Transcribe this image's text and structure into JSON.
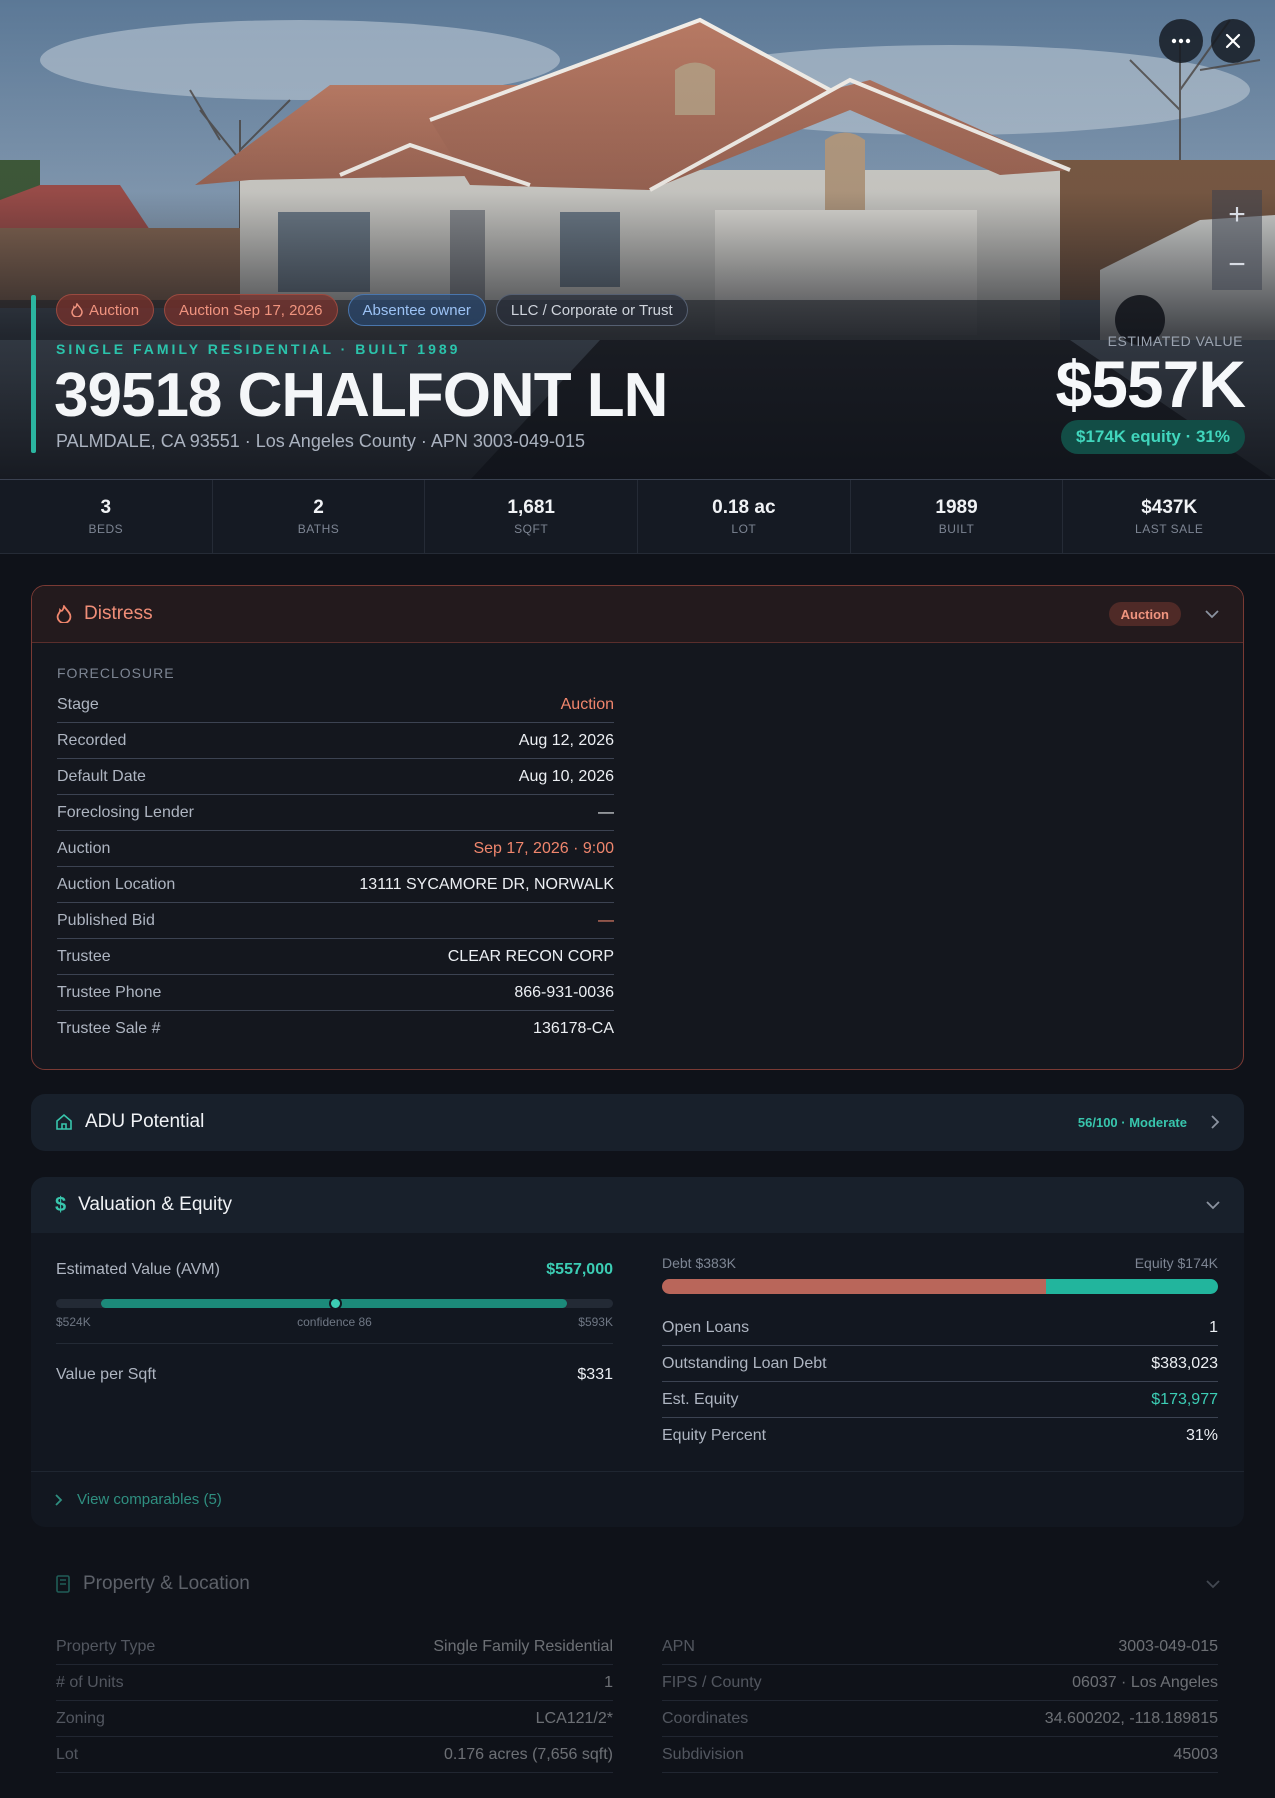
{
  "hero": {
    "tags": [
      {
        "label": "Auction",
        "style": "red",
        "icon": "flame-icon"
      },
      {
        "label": "Auction Sep 17, 2026",
        "style": "red"
      },
      {
        "label": "Absentee owner",
        "style": "blue"
      },
      {
        "label": "LLC / Corporate or Trust",
        "style": "gray"
      }
    ],
    "subtype": "SINGLE FAMILY RESIDENTIAL · BUILT 1989",
    "address": "39518 CHALFONT LN",
    "location": "PALMDALE, CA 93551 · Los Angeles County · APN 3003-049-015",
    "est_label": "ESTIMATED VALUE",
    "est_value": "$557K",
    "equity": "$174K equity · 31%",
    "more_icon": "more-horizontal-icon",
    "close_icon": "close-icon",
    "zoom_in": "+",
    "zoom_out": "−"
  },
  "stats": [
    {
      "value": "3",
      "label": "BEDS"
    },
    {
      "value": "2",
      "label": "BATHS"
    },
    {
      "value": "1,681",
      "label": "SQFT"
    },
    {
      "value": "0.18 ac",
      "label": "LOT"
    },
    {
      "value": "1989",
      "label": "BUILT"
    },
    {
      "value": "$437K",
      "label": "LAST SALE"
    }
  ],
  "distress": {
    "title": "Distress",
    "badge": "Auction",
    "section": "FORECLOSURE",
    "rows": [
      {
        "k": "Stage",
        "v": "Auction",
        "c": "red"
      },
      {
        "k": "Recorded",
        "v": "Aug 12, 2026",
        "c": ""
      },
      {
        "k": "Default Date",
        "v": "Aug 10, 2026",
        "c": ""
      },
      {
        "k": "Foreclosing Lender",
        "v": "—",
        "c": ""
      },
      {
        "k": "Auction",
        "v": "Sep 17, 2026 · 9:00",
        "c": "red"
      },
      {
        "k": "Auction Location",
        "v": "13111 SYCAMORE DR, NORWALK",
        "c": ""
      },
      {
        "k": "Published Bid",
        "v": "—",
        "c": "red"
      },
      {
        "k": "Trustee",
        "v": "CLEAR RECON CORP",
        "c": ""
      },
      {
        "k": "Trustee Phone",
        "v": "866-931-0036",
        "c": ""
      },
      {
        "k": "Trustee Sale #",
        "v": "136178-CA",
        "c": ""
      }
    ]
  },
  "adu": {
    "title": "ADU Potential",
    "score": "56/100 · Moderate"
  },
  "valuation": {
    "title": "Valuation & Equity",
    "avm_label": "Estimated Value (AVM)",
    "avm_value": "$557,000",
    "range_low": "$524K",
    "range_high": "$593K",
    "confidence": "confidence 86",
    "sqft_label": "Value per Sqft",
    "sqft_value": "$331",
    "debt_label": "Debt $383K",
    "equity_label": "Equity $174K",
    "debt_fraction": 0.69,
    "right_rows": [
      {
        "k": "Open Loans",
        "v": "1",
        "c": ""
      },
      {
        "k": "Outstanding Loan Debt",
        "v": "$383,023",
        "c": ""
      },
      {
        "k": "Est. Equity",
        "v": "$173,977",
        "c": "teal"
      },
      {
        "k": "Equity Percent",
        "v": "31%",
        "c": ""
      }
    ],
    "comparables": "View comparables (5)"
  },
  "property": {
    "title": "Property & Location",
    "left_rows": [
      {
        "k": "Property Type",
        "v": "Single Family Residential"
      },
      {
        "k": "# of Units",
        "v": "1"
      },
      {
        "k": "Zoning",
        "v": "LCA121/2*"
      },
      {
        "k": "Lot",
        "v": "0.176 acres (7,656 sqft)"
      }
    ],
    "right_rows": [
      {
        "k": "APN",
        "v": "3003-049-015"
      },
      {
        "k": "FIPS / County",
        "v": "06037 · Los Angeles"
      },
      {
        "k": "Coordinates",
        "v": "34.600202, -118.189815"
      },
      {
        "k": "Subdivision",
        "v": "45003"
      }
    ]
  },
  "colors": {
    "accent": "#2bb5a0",
    "distress": "#f0866d",
    "debt": "#b9665a",
    "equity": "#22b59d"
  }
}
